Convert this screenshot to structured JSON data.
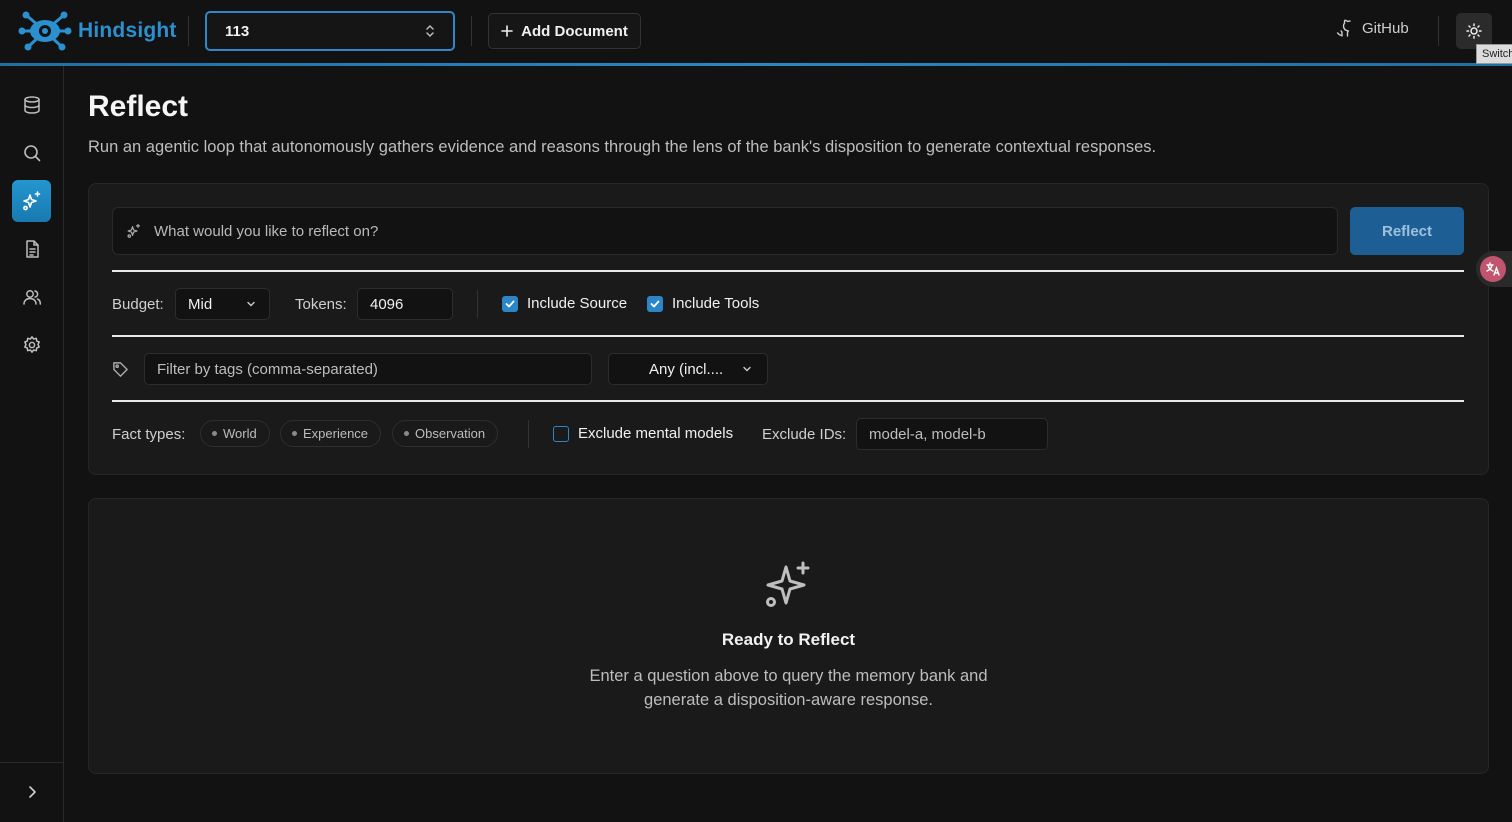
{
  "header": {
    "app_name": "Hindsight",
    "bank_select": {
      "value": "113"
    },
    "add_document_label": "Add Document",
    "github_label": "GitHub",
    "tooltip": "Switch"
  },
  "sidebar": {
    "items": [
      {
        "name": "banks",
        "icon": "database-icon",
        "active": false
      },
      {
        "name": "search",
        "icon": "search-icon",
        "active": false
      },
      {
        "name": "reflect",
        "icon": "sparkles-icon",
        "active": true
      },
      {
        "name": "documents",
        "icon": "document-icon",
        "active": false
      },
      {
        "name": "entities",
        "icon": "users-icon",
        "active": false
      },
      {
        "name": "settings",
        "icon": "gear-icon",
        "active": false
      }
    ]
  },
  "page": {
    "title": "Reflect",
    "description": "Run an agentic loop that autonomously gathers evidence and reasons through the lens of the bank's disposition to generate contextual responses."
  },
  "query": {
    "placeholder": "What would you like to reflect on?",
    "submit_label": "Reflect"
  },
  "options": {
    "budget_label": "Budget:",
    "budget_value": "Mid",
    "tokens_label": "Tokens:",
    "tokens_value": "4096",
    "include_source_label": "Include Source",
    "include_source_checked": true,
    "include_tools_label": "Include Tools",
    "include_tools_checked": true
  },
  "tags": {
    "placeholder": "Filter by tags (comma-separated)",
    "match_value": "Any (incl...."
  },
  "facts": {
    "label": "Fact types:",
    "types": [
      "World",
      "Experience",
      "Observation"
    ],
    "exclude_mental_models_label": "Exclude mental models",
    "exclude_mental_models_checked": false,
    "exclude_ids_label": "Exclude IDs:",
    "exclude_ids_placeholder": "model-a, model-b"
  },
  "empty_state": {
    "title": "Ready to Reflect",
    "line1": "Enter a question above to query the memory bank and",
    "line2": "generate a disposition-aware response."
  },
  "colors": {
    "accent": "#2a86c8",
    "primary_button": "#1d5f94",
    "background": "#121212",
    "card": "#1a1a1a"
  }
}
